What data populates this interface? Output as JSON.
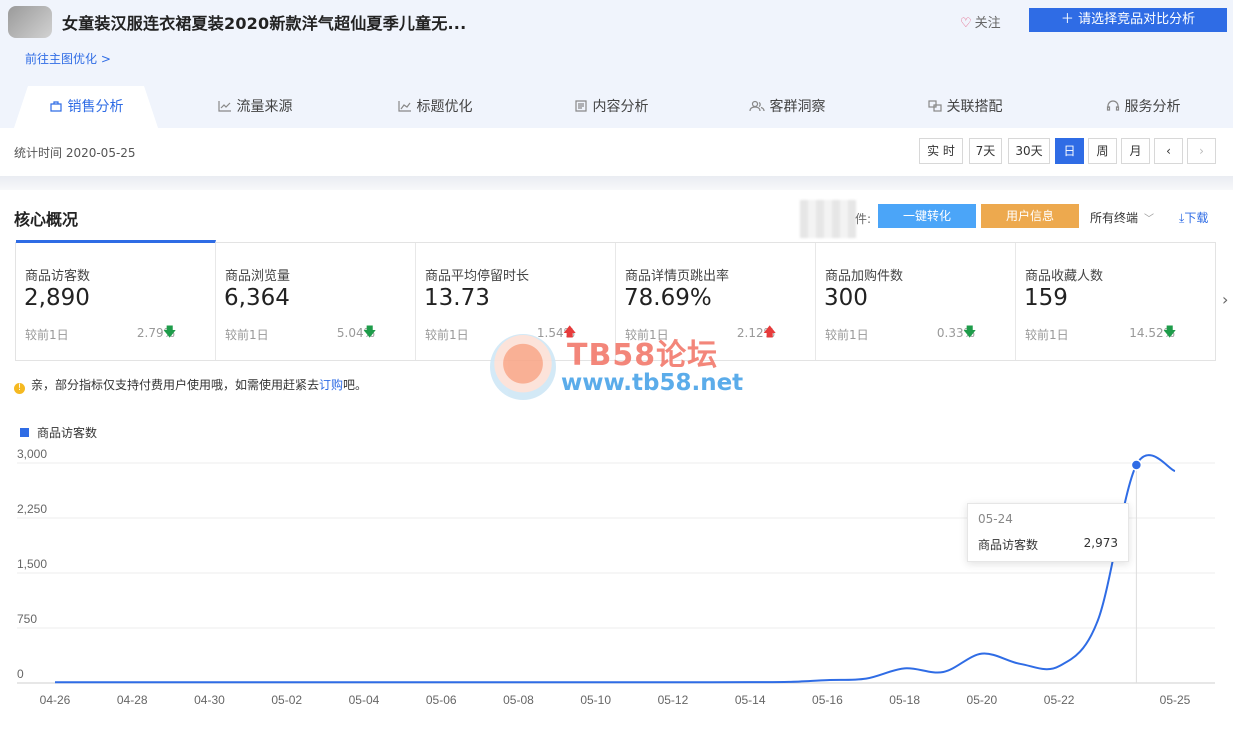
{
  "header": {
    "product_title": "女童装汉服连衣裙夏装2020新款洋气超仙夏季儿童无...",
    "follow_label": "关注",
    "compare_button": "请选择竞品对比分析",
    "goto_link": "前往主图优化 >"
  },
  "tabs": [
    {
      "label": "销售分析",
      "icon": "bag-icon",
      "active": true
    },
    {
      "label": "流量来源",
      "icon": "line-chart-icon"
    },
    {
      "label": "标题优化",
      "icon": "trend-icon"
    },
    {
      "label": "内容分析",
      "icon": "document-icon"
    },
    {
      "label": "客群洞察",
      "icon": "users-icon"
    },
    {
      "label": "关联搭配",
      "icon": "link-icon"
    },
    {
      "label": "服务分析",
      "icon": "headset-icon"
    }
  ],
  "toolbar": {
    "stat_time": "统计时间 2020-05-25",
    "periods": [
      "实 时",
      "7天",
      "30天",
      "日",
      "周",
      "月"
    ],
    "active_period": "日",
    "prev_icon": "chevron-left-icon",
    "next_icon": "chevron-right-icon"
  },
  "core": {
    "title": "核心概况",
    "partial_label": "件:",
    "convert_button": "一键转化",
    "user_info_button": "用户信息",
    "terminal_select": "所有终端",
    "download_label": "下载"
  },
  "metrics": [
    {
      "label": "商品访客数",
      "value": "2,890",
      "compare": "较前1日",
      "change": "2.79%",
      "direction": "down"
    },
    {
      "label": "商品浏览量",
      "value": "6,364",
      "compare": "较前1日",
      "change": "5.04%",
      "direction": "down"
    },
    {
      "label": "商品平均停留时长",
      "value": "13.73",
      "compare": "较前1日",
      "change": "1.54%",
      "direction": "up"
    },
    {
      "label": "商品详情页跳出率",
      "value": "78.69%",
      "compare": "较前1日",
      "change": "2.12%",
      "direction": "up"
    },
    {
      "label": "商品加购件数",
      "value": "300",
      "compare": "较前1日",
      "change": "0.33%",
      "direction": "down"
    },
    {
      "label": "商品收藏人数",
      "value": "159",
      "compare": "较前1日",
      "change": "14.52%",
      "direction": "down"
    }
  ],
  "notice": {
    "icon": "info-icon",
    "text_before": "亲，部分指标仅支持付费用户使用哦，如需使用赶紧去",
    "link": "订购",
    "text_after": "吧。"
  },
  "watermark": {
    "line1": "TB58论坛",
    "line2": "www.tb58.net"
  },
  "colors": {
    "accent": "#2f6ce5",
    "down": "#1e9c4a",
    "up": "#e63b3b",
    "convert": "#4ba5f8",
    "user_info": "#eda94e"
  },
  "tooltip": {
    "date": "05-24",
    "series": "商品访客数",
    "value": "2,973"
  },
  "chart_data": {
    "type": "line",
    "series": [
      {
        "name": "商品访客数",
        "values": [
          10,
          10,
          10,
          10,
          10,
          10,
          10,
          10,
          10,
          10,
          10,
          10,
          10,
          10,
          10,
          10,
          10,
          10,
          12,
          15,
          40,
          60,
          200,
          150,
          400,
          260,
          230,
          850,
          2973,
          2890
        ]
      }
    ],
    "x": [
      "04-26",
      "04-27",
      "04-28",
      "04-29",
      "04-30",
      "05-01",
      "05-02",
      "05-03",
      "05-04",
      "05-05",
      "05-06",
      "05-07",
      "05-08",
      "05-09",
      "05-10",
      "05-11",
      "05-12",
      "05-13",
      "05-14",
      "05-15",
      "05-16",
      "05-17",
      "05-18",
      "05-19",
      "05-20",
      "05-21",
      "05-22",
      "05-23",
      "05-24",
      "05-25"
    ],
    "x_tick_labels": [
      "04-26",
      "04-28",
      "04-30",
      "05-02",
      "05-04",
      "05-06",
      "05-08",
      "05-10",
      "05-12",
      "05-14",
      "05-16",
      "05-18",
      "05-20",
      "05-22",
      "05-25"
    ],
    "y_tick_labels": [
      "3,000",
      "2,250",
      "1,500",
      "750",
      "0"
    ],
    "ylim": [
      0,
      3000
    ],
    "grid": true,
    "legend": "top-left"
  }
}
